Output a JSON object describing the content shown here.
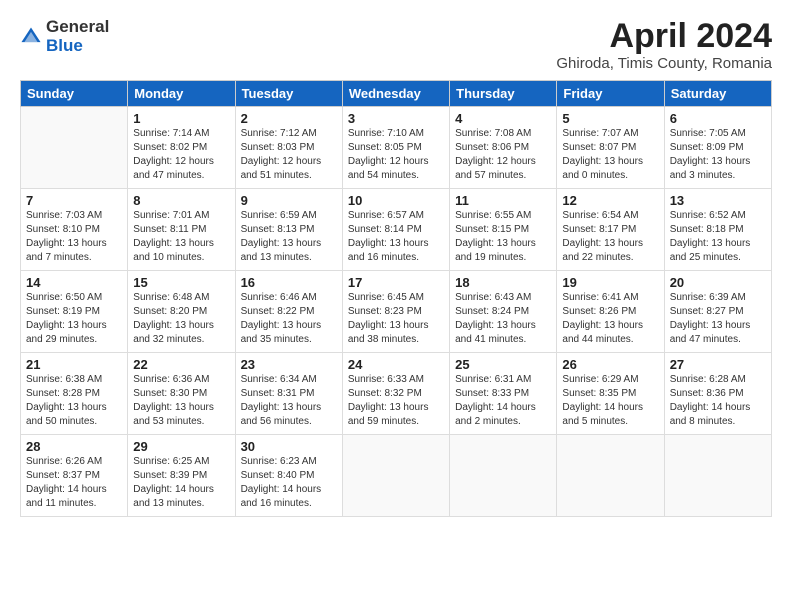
{
  "header": {
    "logo_general": "General",
    "logo_blue": "Blue",
    "title": "April 2024",
    "subtitle": "Ghiroda, Timis County, Romania"
  },
  "days_of_week": [
    "Sunday",
    "Monday",
    "Tuesday",
    "Wednesday",
    "Thursday",
    "Friday",
    "Saturday"
  ],
  "weeks": [
    [
      {
        "day": "",
        "info": ""
      },
      {
        "day": "1",
        "info": "Sunrise: 7:14 AM\nSunset: 8:02 PM\nDaylight: 12 hours\nand 47 minutes."
      },
      {
        "day": "2",
        "info": "Sunrise: 7:12 AM\nSunset: 8:03 PM\nDaylight: 12 hours\nand 51 minutes."
      },
      {
        "day": "3",
        "info": "Sunrise: 7:10 AM\nSunset: 8:05 PM\nDaylight: 12 hours\nand 54 minutes."
      },
      {
        "day": "4",
        "info": "Sunrise: 7:08 AM\nSunset: 8:06 PM\nDaylight: 12 hours\nand 57 minutes."
      },
      {
        "day": "5",
        "info": "Sunrise: 7:07 AM\nSunset: 8:07 PM\nDaylight: 13 hours\nand 0 minutes."
      },
      {
        "day": "6",
        "info": "Sunrise: 7:05 AM\nSunset: 8:09 PM\nDaylight: 13 hours\nand 3 minutes."
      }
    ],
    [
      {
        "day": "7",
        "info": "Sunrise: 7:03 AM\nSunset: 8:10 PM\nDaylight: 13 hours\nand 7 minutes."
      },
      {
        "day": "8",
        "info": "Sunrise: 7:01 AM\nSunset: 8:11 PM\nDaylight: 13 hours\nand 10 minutes."
      },
      {
        "day": "9",
        "info": "Sunrise: 6:59 AM\nSunset: 8:13 PM\nDaylight: 13 hours\nand 13 minutes."
      },
      {
        "day": "10",
        "info": "Sunrise: 6:57 AM\nSunset: 8:14 PM\nDaylight: 13 hours\nand 16 minutes."
      },
      {
        "day": "11",
        "info": "Sunrise: 6:55 AM\nSunset: 8:15 PM\nDaylight: 13 hours\nand 19 minutes."
      },
      {
        "day": "12",
        "info": "Sunrise: 6:54 AM\nSunset: 8:17 PM\nDaylight: 13 hours\nand 22 minutes."
      },
      {
        "day": "13",
        "info": "Sunrise: 6:52 AM\nSunset: 8:18 PM\nDaylight: 13 hours\nand 25 minutes."
      }
    ],
    [
      {
        "day": "14",
        "info": "Sunrise: 6:50 AM\nSunset: 8:19 PM\nDaylight: 13 hours\nand 29 minutes."
      },
      {
        "day": "15",
        "info": "Sunrise: 6:48 AM\nSunset: 8:20 PM\nDaylight: 13 hours\nand 32 minutes."
      },
      {
        "day": "16",
        "info": "Sunrise: 6:46 AM\nSunset: 8:22 PM\nDaylight: 13 hours\nand 35 minutes."
      },
      {
        "day": "17",
        "info": "Sunrise: 6:45 AM\nSunset: 8:23 PM\nDaylight: 13 hours\nand 38 minutes."
      },
      {
        "day": "18",
        "info": "Sunrise: 6:43 AM\nSunset: 8:24 PM\nDaylight: 13 hours\nand 41 minutes."
      },
      {
        "day": "19",
        "info": "Sunrise: 6:41 AM\nSunset: 8:26 PM\nDaylight: 13 hours\nand 44 minutes."
      },
      {
        "day": "20",
        "info": "Sunrise: 6:39 AM\nSunset: 8:27 PM\nDaylight: 13 hours\nand 47 minutes."
      }
    ],
    [
      {
        "day": "21",
        "info": "Sunrise: 6:38 AM\nSunset: 8:28 PM\nDaylight: 13 hours\nand 50 minutes."
      },
      {
        "day": "22",
        "info": "Sunrise: 6:36 AM\nSunset: 8:30 PM\nDaylight: 13 hours\nand 53 minutes."
      },
      {
        "day": "23",
        "info": "Sunrise: 6:34 AM\nSunset: 8:31 PM\nDaylight: 13 hours\nand 56 minutes."
      },
      {
        "day": "24",
        "info": "Sunrise: 6:33 AM\nSunset: 8:32 PM\nDaylight: 13 hours\nand 59 minutes."
      },
      {
        "day": "25",
        "info": "Sunrise: 6:31 AM\nSunset: 8:33 PM\nDaylight: 14 hours\nand 2 minutes."
      },
      {
        "day": "26",
        "info": "Sunrise: 6:29 AM\nSunset: 8:35 PM\nDaylight: 14 hours\nand 5 minutes."
      },
      {
        "day": "27",
        "info": "Sunrise: 6:28 AM\nSunset: 8:36 PM\nDaylight: 14 hours\nand 8 minutes."
      }
    ],
    [
      {
        "day": "28",
        "info": "Sunrise: 6:26 AM\nSunset: 8:37 PM\nDaylight: 14 hours\nand 11 minutes."
      },
      {
        "day": "29",
        "info": "Sunrise: 6:25 AM\nSunset: 8:39 PM\nDaylight: 14 hours\nand 13 minutes."
      },
      {
        "day": "30",
        "info": "Sunrise: 6:23 AM\nSunset: 8:40 PM\nDaylight: 14 hours\nand 16 minutes."
      },
      {
        "day": "",
        "info": ""
      },
      {
        "day": "",
        "info": ""
      },
      {
        "day": "",
        "info": ""
      },
      {
        "day": "",
        "info": ""
      }
    ]
  ]
}
